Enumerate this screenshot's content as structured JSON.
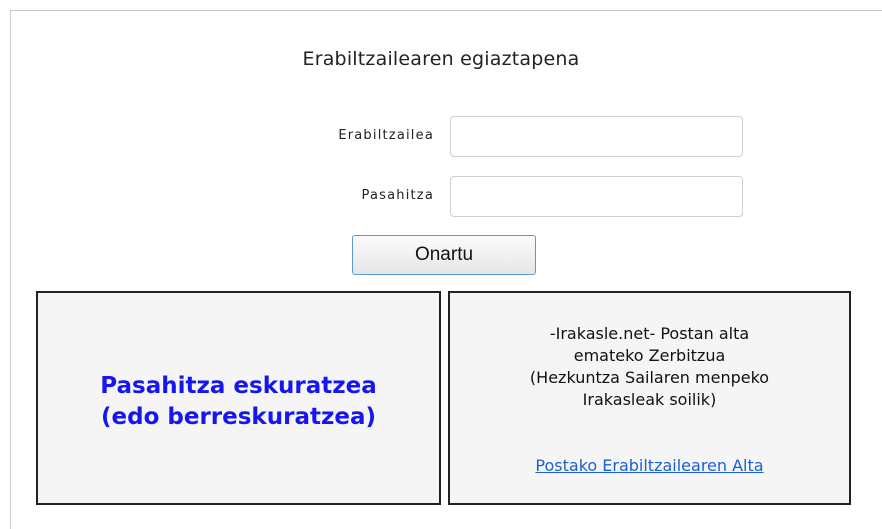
{
  "login": {
    "title": "Erabiltzailearen egiaztapena",
    "username_label": "Erabiltzailea",
    "username_value": "",
    "password_label": "Pasahitza",
    "password_value": "",
    "submit_label": "Onartu"
  },
  "recover_panel": {
    "line1": "Pasahitza eskuratzea",
    "line2": "(edo berreskuratzea)",
    "color": "#1616f0"
  },
  "mail_panel": {
    "lines": [
      "-Irakasle.net- Postan alta",
      "emateko Zerbitzua",
      "(Hezkuntza Sailaren menpeko",
      "Irakasleak soilik)"
    ],
    "link_label": "Postako Erabiltzailearen Alta",
    "link_color": "#1a5fd4"
  }
}
